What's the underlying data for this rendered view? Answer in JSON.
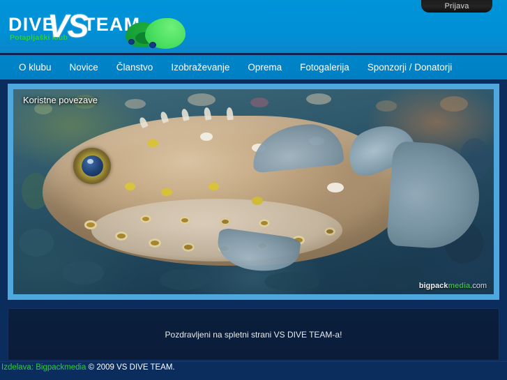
{
  "site": {
    "logo": {
      "word_left": "DIVE",
      "word_vs": "VS",
      "word_right": "TEAM",
      "subtitle": "Potapljaški klub",
      "mascot_icon": "two-fish-icon"
    },
    "login_tab": {
      "label": "Prijava"
    },
    "nav": {
      "items": [
        {
          "label": "O klubu"
        },
        {
          "label": "Novice"
        },
        {
          "label": "Članstvo"
        },
        {
          "label": "Izobraževanje"
        },
        {
          "label": "Oprema"
        },
        {
          "label": "Fotogalerija"
        },
        {
          "label": "Sponzorji / Donatorji"
        }
      ]
    },
    "hero": {
      "label": "Koristne povezave",
      "image_subject": "pufferfish-underwater-photo",
      "watermark": {
        "part1": "bigpack",
        "part2": "media",
        "part3": ".com"
      }
    },
    "welcome": {
      "message": "Pozdravljeni na spletni strani VS DIVE TEAM-a!"
    },
    "footer": {
      "credit_prefix": "Izdelava: Bigpackmedia",
      "credit_suffix": "© 2009 VS DIVE TEAM."
    },
    "colors": {
      "banner_blue": "#0093d8",
      "nav_blue": "#0084c8",
      "page_navy": "#0b2d5e",
      "panel_navy": "#0a1f3e",
      "frame_blue": "#4fa8dd",
      "accent_green": "#2ecc40",
      "tab_dark": "#1b1b1b"
    }
  }
}
